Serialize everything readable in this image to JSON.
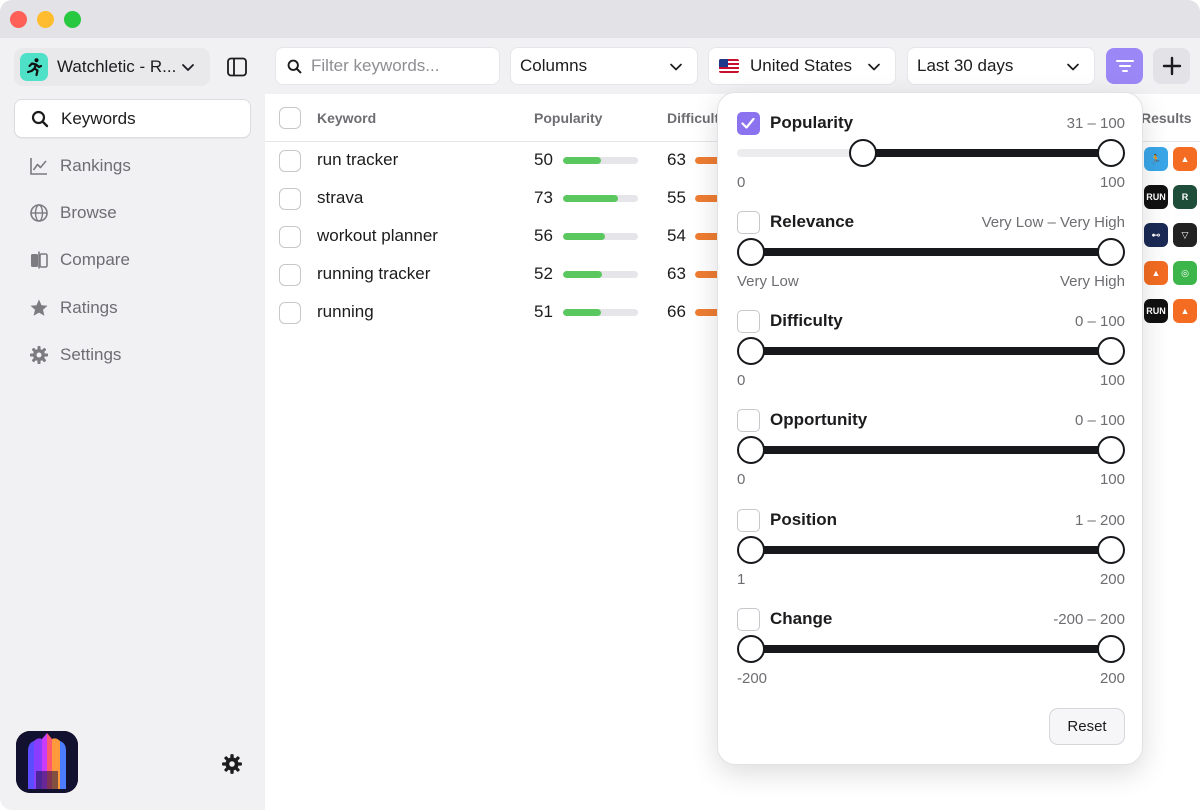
{
  "app": {
    "name": "Watchletic - R...",
    "accent": "#8b73ef"
  },
  "sidebar": {
    "items": [
      {
        "label": "Keywords",
        "icon": "search-icon",
        "active": true
      },
      {
        "label": "Rankings",
        "icon": "chart-line-icon",
        "active": false
      },
      {
        "label": "Browse",
        "icon": "globe-icon",
        "active": false
      },
      {
        "label": "Compare",
        "icon": "compare-icon",
        "active": false
      },
      {
        "label": "Ratings",
        "icon": "star-icon",
        "active": false
      },
      {
        "label": "Settings",
        "icon": "gear-icon",
        "active": false
      }
    ]
  },
  "toolbar": {
    "filter_placeholder": "Filter keywords...",
    "columns_label": "Columns",
    "country_label": "United States",
    "date_label": "Last 30 days"
  },
  "table": {
    "headers": {
      "keyword": "Keyword",
      "popularity": "Popularity",
      "difficulty": "Difficult",
      "results": "Results"
    },
    "rows": [
      {
        "keyword": "run tracker",
        "popularity": 50,
        "difficulty": 63
      },
      {
        "keyword": "strava",
        "popularity": 73,
        "difficulty": 55
      },
      {
        "keyword": "workout planner",
        "popularity": 56,
        "difficulty": 54
      },
      {
        "keyword": "running tracker",
        "popularity": 52,
        "difficulty": 63
      },
      {
        "keyword": "running",
        "popularity": 51,
        "difficulty": 66
      }
    ],
    "colors": {
      "popularity": "#5ac85e",
      "difficulty": "#ef7d32"
    }
  },
  "filters": {
    "popularity": {
      "label": "Popularity",
      "checked": true,
      "range_text": "31 – 100",
      "min_label": "0",
      "max_label": "100",
      "low": 0.31,
      "high": 1.0
    },
    "relevance": {
      "label": "Relevance",
      "checked": false,
      "range_text": "Very Low – Very High",
      "min_label": "Very Low",
      "max_label": "Very High",
      "low": 0.0,
      "high": 1.0
    },
    "difficulty": {
      "label": "Difficulty",
      "checked": false,
      "range_text": "0 – 100",
      "min_label": "0",
      "max_label": "100",
      "low": 0.0,
      "high": 1.0
    },
    "opportunity": {
      "label": "Opportunity",
      "checked": false,
      "range_text": "0 – 100",
      "min_label": "0",
      "max_label": "100",
      "low": 0.0,
      "high": 1.0
    },
    "position": {
      "label": "Position",
      "checked": false,
      "range_text": "1 – 200",
      "min_label": "1",
      "max_label": "200",
      "low": 0.0,
      "high": 1.0
    },
    "change": {
      "label": "Change",
      "checked": false,
      "range_text": "-200 – 200",
      "min_label": "-200",
      "max_label": "200",
      "low": 0.0,
      "high": 1.0
    },
    "reset_label": "Reset"
  }
}
